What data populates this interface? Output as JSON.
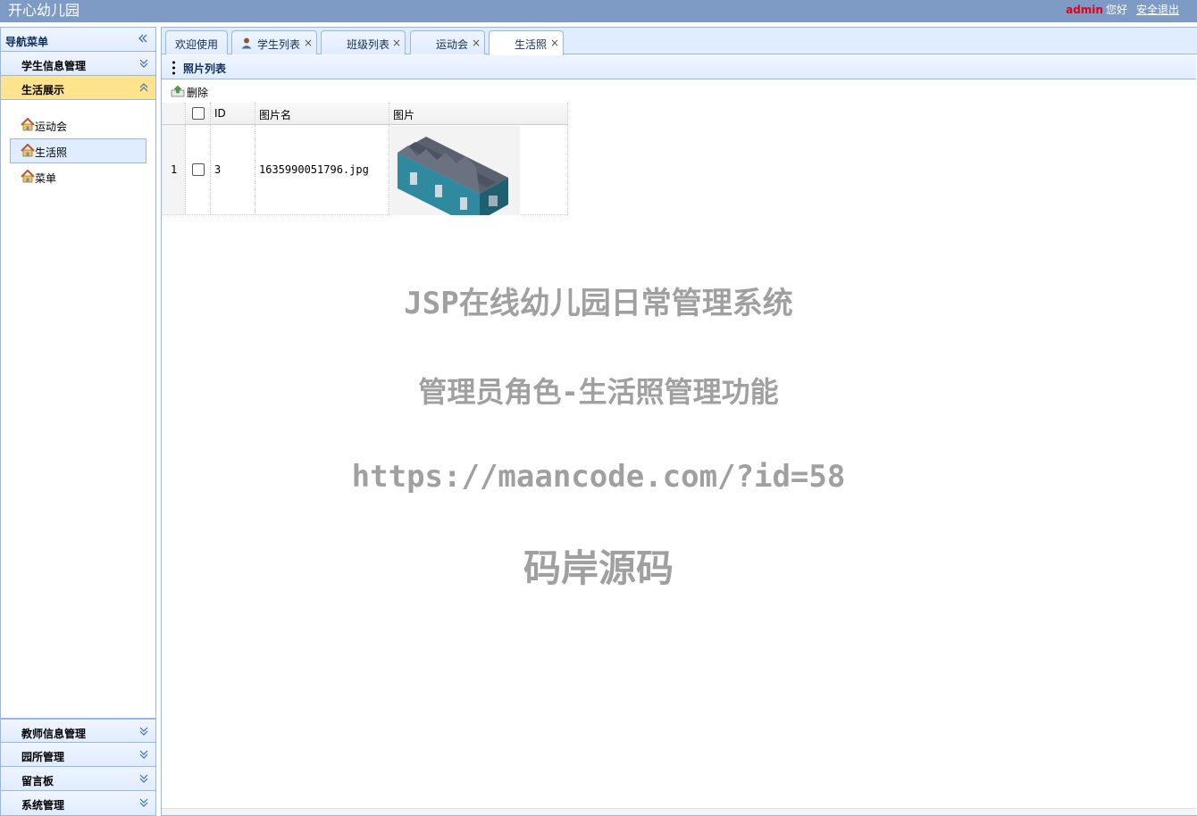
{
  "header": {
    "title": "开心幼儿园",
    "user": "admin",
    "greeting": "您好",
    "logout": "安全退出"
  },
  "sidebar": {
    "title": "导航菜单",
    "sections_top": [
      {
        "label": "学生信息管理",
        "state": "collapsed"
      },
      {
        "label": "生活展示",
        "state": "expanded"
      }
    ],
    "items": [
      {
        "label": "运动会",
        "icon": "home-icon"
      },
      {
        "label": "生活照",
        "icon": "home-icon"
      },
      {
        "label": "菜单",
        "icon": "home-icon"
      }
    ],
    "sections_bottom": [
      {
        "label": "教师信息管理"
      },
      {
        "label": "园所管理"
      },
      {
        "label": "留言板"
      },
      {
        "label": "系统管理"
      }
    ]
  },
  "tabs": [
    {
      "label": "欢迎使用",
      "closable": false
    },
    {
      "label": "学生列表",
      "closable": true,
      "icon": "user-icon"
    },
    {
      "label": "班级列表",
      "closable": true
    },
    {
      "label": "运动会",
      "closable": true
    },
    {
      "label": "生活照",
      "closable": true
    }
  ],
  "tab_close": "×",
  "panel": {
    "title": "照片列表"
  },
  "toolbar": {
    "delete_label": "删除"
  },
  "grid": {
    "columns": [
      "ID",
      "图片名",
      "图片"
    ],
    "rows": [
      {
        "num": "1",
        "id": "3",
        "name": "1635990051796.jpg",
        "image": "warehouse-building-image"
      }
    ]
  },
  "watermark": {
    "line1": "JSP在线幼儿园日常管理系统",
    "line2": "管理员角色-生活照管理功能",
    "line3": "https://maancode.com/?id=58",
    "line4": "码岸源码"
  },
  "colors": {
    "header_bg": "#7d9bc4",
    "border": "#95b8e7",
    "selected_section": "#ffe48d",
    "username": "#e60012"
  }
}
